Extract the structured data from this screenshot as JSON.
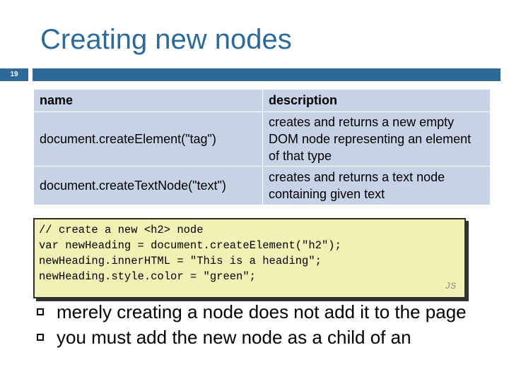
{
  "slide": {
    "title": "Creating new nodes",
    "number": "19"
  },
  "table": {
    "headers": [
      "name",
      "description"
    ],
    "rows": [
      {
        "name": "document.createElement(\"tag\")",
        "description": "creates and returns a new empty DOM node representing an element of that type"
      },
      {
        "name": "document.createTextNode(\"text\")",
        "description": "creates and returns a text node containing given text"
      }
    ]
  },
  "code": {
    "lines": [
      "// create a new <h2> node",
      "var newHeading = document.createElement(\"h2\");",
      "newHeading.innerHTML = \"This is a heading\";",
      "newHeading.style.color = \"green\";"
    ],
    "language_label": "JS"
  },
  "bullets": [
    "merely creating a node does not add it to the page",
    "you must add the new node as a child of an"
  ],
  "colors": {
    "accent": "#2e6a99",
    "table_cell": "#c6d2e6",
    "code_bg": "#f1f1b6"
  }
}
